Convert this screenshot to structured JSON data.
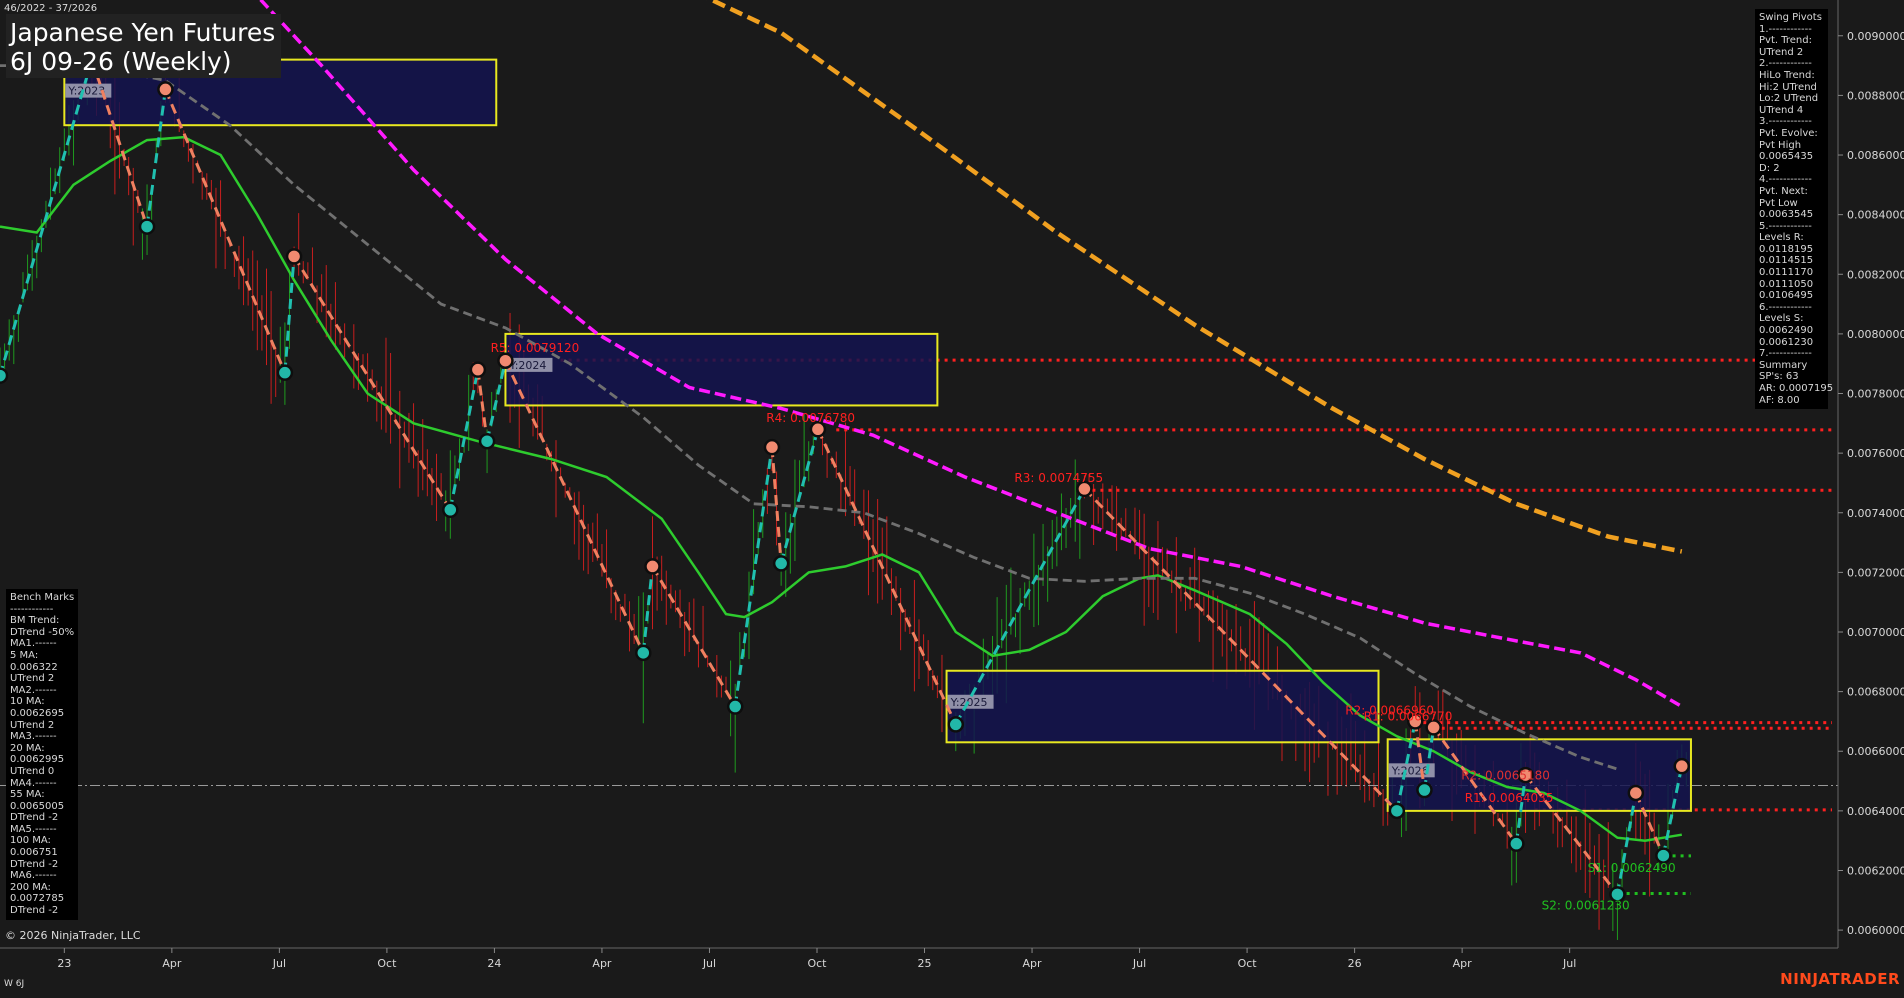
{
  "header": {
    "date_range": "46/2022 - 37/2026",
    "title_line1": "Japanese Yen Futures",
    "title_line2": "6J 09-26 (Weekly)"
  },
  "footer": {
    "copyright": "© 2026 NinjaTrader, LLC",
    "symbol_tag": "W 6J",
    "brand": "NINJATRADER"
  },
  "swing_pivots_panel": [
    "Swing Pivots",
    "1.------------",
    "Pvt. Trend:",
    "UTrend 2",
    "2.------------",
    "HiLo Trend:",
    "Hi:2 UTrend",
    "Lo:2 UTrend",
    "UTrend 4",
    "3.------------",
    "Pvt. Evolve:",
    "Pvt High",
    "0.0065435",
    "D: 2",
    "4.------------",
    "Pvt. Next:",
    "Pvt Low",
    "0.0063545",
    "5.------------",
    "Levels R:",
    "0.0118195",
    "0.0114515",
    "0.0111170",
    "0.0111050",
    "0.0106495",
    "6.------------",
    "Levels S:",
    "0.0062490",
    "0.0061230",
    "7.------------",
    "Summary",
    "SP's: 63",
    "AR: 0.0007195",
    "AF: 8.00"
  ],
  "bench_marks_panel": [
    "Bench Marks",
    "------------",
    "BM Trend:",
    "DTrend -50%",
    "MA1.------",
    "5 MA:",
    "0.006322",
    "UTrend 2",
    "MA2.------",
    "10 MA:",
    "0.0062695",
    "UTrend 2",
    "MA3.------",
    "20 MA:",
    "0.0062995",
    "UTrend 0",
    "MA4.------",
    "55 MA:",
    "0.0065005",
    "DTrend -2",
    "MA5.------",
    "100 MA:",
    "0.006751",
    "DTrend -2",
    "MA6.------",
    "200 MA:",
    "0.0072785",
    "DTrend -2"
  ],
  "chart_data": {
    "type": "line",
    "instrument": "6J 09-26 (Weekly)",
    "x_labels": [
      "23",
      "Apr",
      "Jul",
      "Oct",
      "24",
      "Apr",
      "Jul",
      "Oct",
      "25",
      "Apr",
      "Jul",
      "Oct",
      "26",
      "Apr",
      "Jul"
    ],
    "y_ticks": [
      "0.0060000",
      "0.0062000",
      "0.0064000",
      "0.0066000",
      "0.0068000",
      "0.0070000",
      "0.0072000",
      "0.0074000",
      "0.0076000",
      "0.0078000",
      "0.0080000",
      "0.0082000",
      "0.0084000",
      "0.0086000",
      "0.0088000",
      "0.0090000"
    ],
    "ylim": [
      0.00594,
      0.00912
    ],
    "xlim": [
      0,
      200
    ],
    "current_price": 0.006485,
    "colors": {
      "ma_green": "#2ecc2e",
      "ma_gray": "#707070",
      "ma_magenta": "#ff1aff",
      "ma_orange": "#f0a020",
      "swing_up": "#20c0b0",
      "swing_down": "#f08060",
      "resistance": "#ff2020",
      "support": "#20c020",
      "year_box_fill": "#141450",
      "year_box_border": "#e8e820",
      "bar_up": "#1f9a1f",
      "bar_down": "#c81e1e"
    },
    "resistance_levels": [
      {
        "label": "R5: 0.0079120",
        "value": 0.007912,
        "from_x": 61
      },
      {
        "label": "R4: 0.0076780",
        "value": 0.007678,
        "from_x": 91
      },
      {
        "label": "R3: 0.0074755",
        "value": 0.0074755,
        "from_x": 118
      },
      {
        "label": "R2: 0.0066960",
        "value": 0.006696,
        "from_x": 154
      },
      {
        "label": "R1: 0.0066770",
        "value": 0.006677,
        "from_x": 156
      },
      {
        "label": "R1: 0.0064035",
        "value": 0.0064035,
        "from_x": 167
      }
    ],
    "support_levels": [
      {
        "label": "S1: 0.0062490",
        "value": 0.006249,
        "from_x": 182
      },
      {
        "label": "S2: 0.0061230",
        "value": 0.006123,
        "from_x": 177
      }
    ],
    "other_level_labels": [
      {
        "label": "R2: 0.0065180",
        "value": 0.006518,
        "x": 159
      }
    ],
    "year_boxes": [
      {
        "label": "Y:2023",
        "x0": 7,
        "x1": 54,
        "y_high": 0.00892,
        "y_low": 0.0087
      },
      {
        "label": "Y:2024",
        "x0": 55,
        "x1": 102,
        "y_high": 0.008,
        "y_low": 0.00776
      },
      {
        "label": "Y:2025",
        "x0": 103,
        "x1": 150,
        "y_high": 0.00687,
        "y_low": 0.00663
      },
      {
        "label": "Y:2026",
        "x0": 151,
        "x1": 184,
        "y_high": 0.00664,
        "y_low": 0.0064
      }
    ],
    "swing_pivots": [
      {
        "x": 0,
        "y": 0.00786,
        "type": "low"
      },
      {
        "x": 10,
        "y": 0.00892,
        "type": "high"
      },
      {
        "x": 16,
        "y": 0.00836,
        "type": "low"
      },
      {
        "x": 18,
        "y": 0.00882,
        "type": "high"
      },
      {
        "x": 31,
        "y": 0.00787,
        "type": "low"
      },
      {
        "x": 32,
        "y": 0.00826,
        "type": "high"
      },
      {
        "x": 49,
        "y": 0.00741,
        "type": "low"
      },
      {
        "x": 52,
        "y": 0.00788,
        "type": "high"
      },
      {
        "x": 53,
        "y": 0.00764,
        "type": "low"
      },
      {
        "x": 55,
        "y": 0.00791,
        "type": "high"
      },
      {
        "x": 70,
        "y": 0.00693,
        "type": "low"
      },
      {
        "x": 71,
        "y": 0.00722,
        "type": "high"
      },
      {
        "x": 80,
        "y": 0.00675,
        "type": "low"
      },
      {
        "x": 84,
        "y": 0.00762,
        "type": "high"
      },
      {
        "x": 85,
        "y": 0.00723,
        "type": "low"
      },
      {
        "x": 89,
        "y": 0.00768,
        "type": "high"
      },
      {
        "x": 104,
        "y": 0.00669,
        "type": "low"
      },
      {
        "x": 118,
        "y": 0.00748,
        "type": "high"
      },
      {
        "x": 152,
        "y": 0.0064,
        "type": "low"
      },
      {
        "x": 154,
        "y": 0.0067,
        "type": "high"
      },
      {
        "x": 155,
        "y": 0.00647,
        "type": "low"
      },
      {
        "x": 156,
        "y": 0.00668,
        "type": "high"
      },
      {
        "x": 165,
        "y": 0.00629,
        "type": "low"
      },
      {
        "x": 166,
        "y": 0.00652,
        "type": "high"
      },
      {
        "x": 176,
        "y": 0.00612,
        "type": "low"
      },
      {
        "x": 178,
        "y": 0.00646,
        "type": "high"
      },
      {
        "x": 181,
        "y": 0.00625,
        "type": "low"
      },
      {
        "x": 183,
        "y": 0.00655,
        "type": "high"
      }
    ],
    "series": [
      {
        "name": "20 MA",
        "color_key": "ma_green",
        "dash": "",
        "width": 2.5,
        "points": [
          [
            0,
            0.00836
          ],
          [
            4,
            0.00834
          ],
          [
            8,
            0.0085
          ],
          [
            12,
            0.00858
          ],
          [
            16,
            0.00865
          ],
          [
            20,
            0.00866
          ],
          [
            24,
            0.0086
          ],
          [
            28,
            0.0084
          ],
          [
            32,
            0.00818
          ],
          [
            36,
            0.00798
          ],
          [
            40,
            0.0078
          ],
          [
            45,
            0.0077
          ],
          [
            52,
            0.00764
          ],
          [
            60,
            0.00758
          ],
          [
            66,
            0.00752
          ],
          [
            72,
            0.00738
          ],
          [
            76,
            0.0072
          ],
          [
            79,
            0.00706
          ],
          [
            81,
            0.00705
          ],
          [
            84,
            0.0071
          ],
          [
            88,
            0.0072
          ],
          [
            92,
            0.00722
          ],
          [
            96,
            0.00726
          ],
          [
            100,
            0.0072
          ],
          [
            104,
            0.007
          ],
          [
            108,
            0.00692
          ],
          [
            112,
            0.00694
          ],
          [
            116,
            0.007
          ],
          [
            120,
            0.00712
          ],
          [
            124,
            0.00718
          ],
          [
            126,
            0.00719
          ],
          [
            130,
            0.00714
          ],
          [
            136,
            0.00706
          ],
          [
            140,
            0.00696
          ],
          [
            144,
            0.00683
          ],
          [
            148,
            0.00672
          ],
          [
            152,
            0.00665
          ],
          [
            156,
            0.0066
          ],
          [
            160,
            0.00653
          ],
          [
            164,
            0.00648
          ],
          [
            168,
            0.00646
          ],
          [
            172,
            0.0064
          ],
          [
            176,
            0.00631
          ],
          [
            179,
            0.0063
          ],
          [
            183,
            0.00632
          ]
        ]
      },
      {
        "name": "55 MA",
        "color_key": "ma_gray",
        "dash": "9 5",
        "width": 2.8,
        "points": [
          [
            0,
            0.0089
          ],
          [
            10,
            0.0089
          ],
          [
            18,
            0.00885
          ],
          [
            25,
            0.0087
          ],
          [
            32,
            0.0085
          ],
          [
            40,
            0.0083
          ],
          [
            48,
            0.0081
          ],
          [
            55,
            0.00802
          ],
          [
            62,
            0.0079
          ],
          [
            70,
            0.00772
          ],
          [
            76,
            0.00756
          ],
          [
            82,
            0.00743
          ],
          [
            88,
            0.00742
          ],
          [
            94,
            0.0074
          ],
          [
            100,
            0.00733
          ],
          [
            106,
            0.00725
          ],
          [
            112,
            0.00718
          ],
          [
            118,
            0.00717
          ],
          [
            124,
            0.00718
          ],
          [
            130,
            0.00718
          ],
          [
            136,
            0.00713
          ],
          [
            142,
            0.00706
          ],
          [
            148,
            0.00698
          ],
          [
            154,
            0.00686
          ],
          [
            160,
            0.00675
          ],
          [
            166,
            0.00666
          ],
          [
            172,
            0.00658
          ],
          [
            176,
            0.00654
          ]
        ]
      },
      {
        "name": "100 MA",
        "color_key": "ma_magenta",
        "dash": "11 5",
        "width": 3.5,
        "points": [
          [
            26,
            0.0092
          ],
          [
            35,
            0.0089
          ],
          [
            45,
            0.00855
          ],
          [
            55,
            0.00825
          ],
          [
            65,
            0.008
          ],
          [
            75,
            0.00782
          ],
          [
            85,
            0.00775
          ],
          [
            95,
            0.00766
          ],
          [
            105,
            0.00752
          ],
          [
            115,
            0.0074
          ],
          [
            125,
            0.00728
          ],
          [
            135,
            0.00722
          ],
          [
            145,
            0.00712
          ],
          [
            155,
            0.00703
          ],
          [
            165,
            0.00697
          ],
          [
            172,
            0.00693
          ],
          [
            178,
            0.00684
          ],
          [
            183,
            0.00675
          ]
        ]
      },
      {
        "name": "200 MA",
        "color_key": "ma_orange",
        "dash": "13 6",
        "width": 4.5,
        "points": [
          [
            72,
            0.0092
          ],
          [
            85,
            0.00901
          ],
          [
            100,
            0.00868
          ],
          [
            115,
            0.00834
          ],
          [
            130,
            0.00803
          ],
          [
            145,
            0.00775
          ],
          [
            155,
            0.00758
          ],
          [
            165,
            0.00743
          ],
          [
            175,
            0.00732
          ],
          [
            183,
            0.00727
          ]
        ]
      }
    ]
  }
}
